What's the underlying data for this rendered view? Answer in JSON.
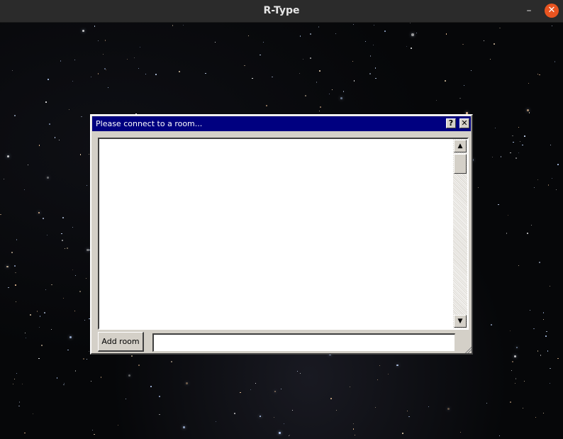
{
  "window": {
    "title": "R-Type",
    "minimize_glyph": "–",
    "close_glyph": "✕"
  },
  "dialog": {
    "title": "Please connect to a room...",
    "help_glyph": "?",
    "close_glyph": "✕",
    "rooms": [],
    "add_room_label": "Add room",
    "room_name_value": "",
    "scroll_up_glyph": "▲",
    "scroll_down_glyph": "▼"
  },
  "colors": {
    "titlebar": "#2b2b2b",
    "close_accent": "#e95420",
    "dialog_title_bg": "#000080",
    "dialog_face": "#d4d0c8"
  }
}
